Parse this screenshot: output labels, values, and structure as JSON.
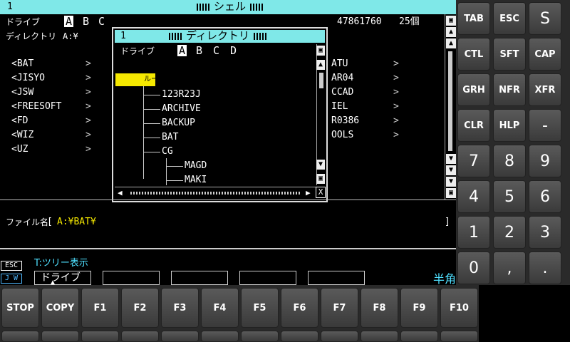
{
  "titlebar": {
    "number": "1",
    "title": "シェル"
  },
  "header": {
    "drive_label": "ドライブ",
    "drives": [
      "A",
      "B",
      "C"
    ],
    "dir_label": "ディレクトリ",
    "dir_value": "A:¥",
    "free_bytes": "47861760",
    "count": "25個"
  },
  "left_list": [
    "<BAT",
    "<JISYO",
    "<JSW",
    "<FREESOFT",
    "<FD",
    "<WIZ",
    "<UZ"
  ],
  "right_list": [
    "ATU",
    "AR04",
    "CCAD",
    "IEL",
    "R0386",
    "OOLS"
  ],
  "chevron": ">",
  "dialog": {
    "number": "1",
    "title": "ディレクトリ",
    "drive_label": "ドライブ",
    "drives": [
      "A",
      "B",
      "C",
      "D"
    ],
    "root_label": "ルート",
    "tree": [
      "123R23J",
      "ARCHIVE",
      "BACKUP",
      "BAT",
      "CG",
      "MAGD",
      "MAKI"
    ],
    "close": "X"
  },
  "filename": {
    "label": "ファイル名",
    "bracket_open": "[",
    "value": "A:¥BAT¥",
    "bracket_close": "]"
  },
  "hint": {
    "esc": "ESC",
    "text": "T:ツリー表示",
    "jw": "J W"
  },
  "function_boxes": [
    "ドライブ",
    "",
    "",
    "",
    "",
    ""
  ],
  "ime_mode": "半角",
  "right_keys": [
    "TAB",
    "ESC",
    "S",
    "CTL",
    "SFT",
    "CAP",
    "GRH",
    "NFR",
    "XFR",
    "CLR",
    "HLP",
    "-",
    "7",
    "8",
    "9",
    "4",
    "5",
    "6",
    "1",
    "2",
    "3",
    "0",
    ",",
    "."
  ],
  "bottom_keys": [
    "STOP",
    "COPY",
    "F1",
    "F2",
    "F3",
    "F4",
    "F5",
    "F6",
    "F7",
    "F8",
    "F9",
    "F10"
  ]
}
